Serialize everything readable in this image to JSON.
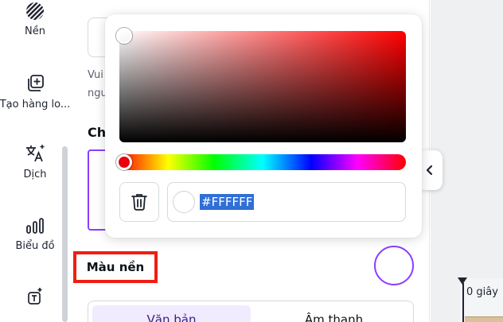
{
  "rail": {
    "items": [
      {
        "label": "Nền",
        "icon": "hatch-background-icon"
      },
      {
        "label": "Tạo hàng lo...",
        "icon": "bulk-create-icon"
      },
      {
        "label": "Dịch",
        "icon": "translate-icon"
      },
      {
        "label": "Biểu đồ",
        "icon": "chart-icon"
      },
      {
        "label": "",
        "icon": "text-frame-icon"
      }
    ]
  },
  "panel": {
    "hint_line1": "Vui",
    "hint_line2": "ngu",
    "section_heading": "Ch",
    "background_color_label": "Màu nền",
    "tabs": [
      {
        "label": "Văn bản",
        "active": true
      },
      {
        "label": "Âm thanh",
        "active": false
      }
    ]
  },
  "picker": {
    "hex_value": "#FFFFFF",
    "hue_color": "#ff0000"
  },
  "timeline": {
    "time_label": "0 giây"
  },
  "colors": {
    "accent_purple": "#8b3dff",
    "highlight_red": "#ee1f12",
    "selection_blue": "#2f6fd6"
  }
}
